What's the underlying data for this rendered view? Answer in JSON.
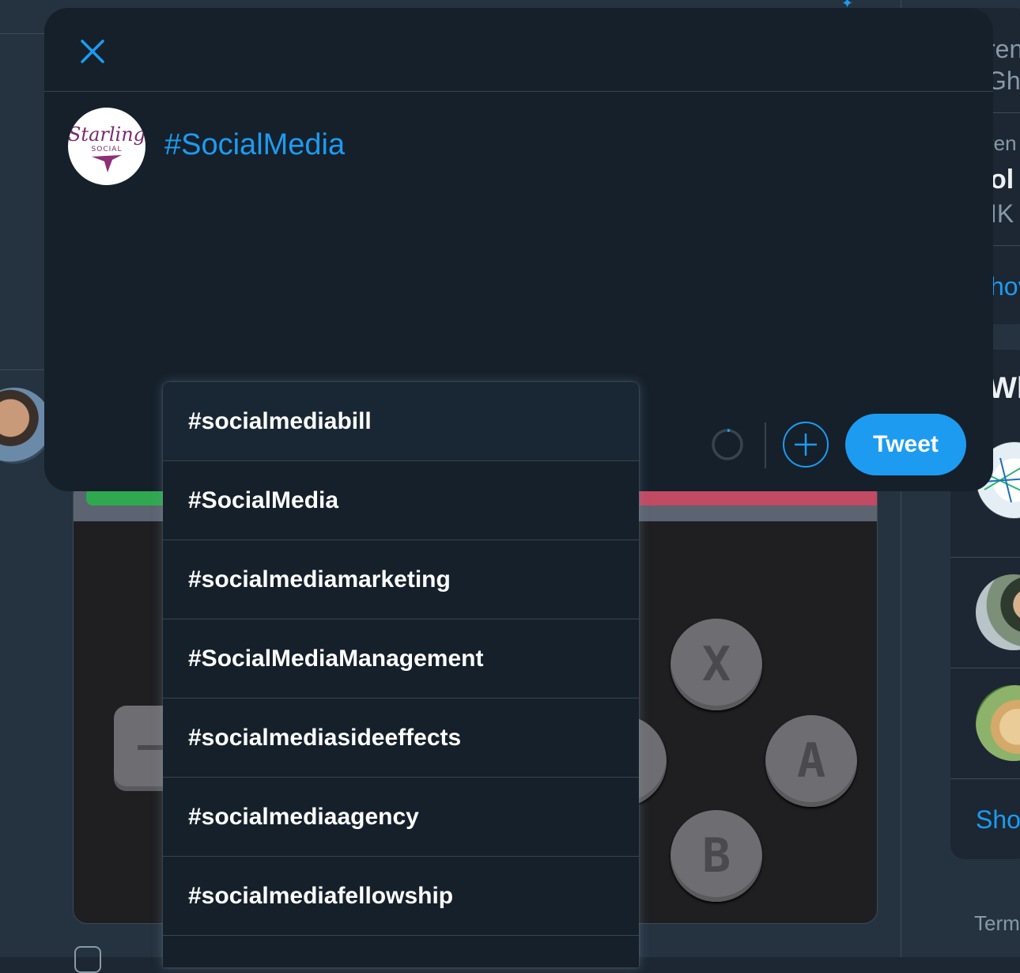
{
  "compose": {
    "text": "#SocialMedia",
    "tweet_label": "Tweet",
    "avatar_logo_text": "Starling",
    "avatar_logo_subtext": "SOCIAL"
  },
  "autocomplete": {
    "items": [
      "#socialmediabill",
      "#SocialMedia",
      "#socialmediamarketing",
      "#SocialMediaManagement",
      "#socialmediasideeffects",
      "#socialmediaagency",
      "#socialmediafellowship"
    ]
  },
  "background": {
    "right_trend1_line1": "ren",
    "right_trend1_line2": "Gh",
    "right_trend2_line1": "ren",
    "right_trend2_bold": "ol",
    "right_trend2_count": "IK",
    "right_show1": "hov",
    "right_who_heading": "Wh",
    "right_show2": "Sho",
    "right_footer": "Term",
    "game_buttons": [
      "X",
      "A",
      "B"
    ]
  },
  "colors": {
    "accent": "#1d9bf0",
    "modal_bg": "#15202b",
    "border": "#38444d"
  }
}
